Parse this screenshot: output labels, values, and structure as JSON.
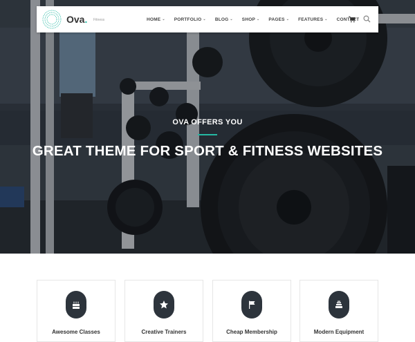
{
  "brand": {
    "name": "Ova",
    "dot": ".",
    "tagline": "Fitness"
  },
  "nav": {
    "items": [
      {
        "label": "HOME",
        "has_dropdown": true
      },
      {
        "label": "PORTFOLIO",
        "has_dropdown": true
      },
      {
        "label": "BLOG",
        "has_dropdown": true
      },
      {
        "label": "SHOP",
        "has_dropdown": true
      },
      {
        "label": "PAGES",
        "has_dropdown": true
      },
      {
        "label": "FEATURES",
        "has_dropdown": true
      },
      {
        "label": "CONTACT",
        "has_dropdown": false
      }
    ],
    "chevron": "⌄",
    "icons": [
      "cart-icon",
      "search-icon"
    ]
  },
  "hero": {
    "eyebrow": "OVA OFFERS YOU",
    "headline": "GREAT THEME FOR SPORT & FITNESS WEBSITES"
  },
  "features": [
    {
      "label": "Awesome Classes",
      "icon": "cake-icon"
    },
    {
      "label": "Creative Trainers",
      "icon": "star-icon"
    },
    {
      "label": "Cheap Membership",
      "icon": "flag-icon"
    },
    {
      "label": "Modern Equipment",
      "icon": "equipment-icon"
    }
  ],
  "colors": {
    "accent": "#25b9a4",
    "badge": "#2d343c",
    "nav_text": "#444444"
  }
}
